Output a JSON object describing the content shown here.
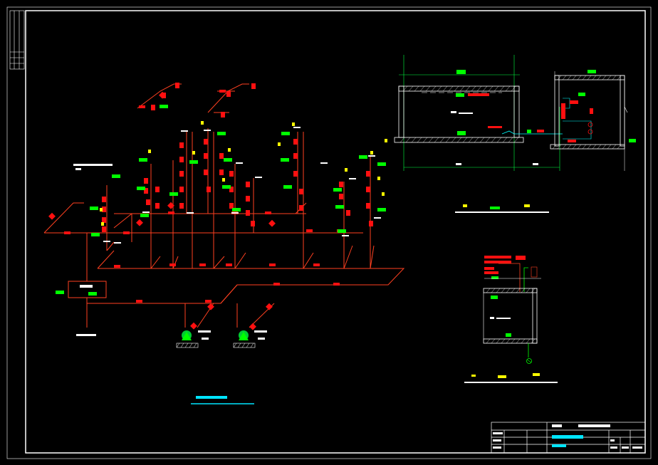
{
  "drawing": {
    "background": "#000000",
    "colors": {
      "frame": "#ffffff",
      "pipe": "#ff4020",
      "valve": "#ff1010",
      "tag": "#00ff00",
      "tag_alt": "#ffff00",
      "title": "#00e5ff",
      "wall": "#ffffff",
      "water": "#00ffff"
    }
  },
  "left_strip": {
    "cells": 5
  },
  "main_system": {
    "title_bar_color": "#00e5ff",
    "risers": 9,
    "pumps": 2,
    "tank_label": "",
    "note_label": ""
  },
  "plan_view": {
    "title_color": "#ffffff"
  },
  "detail_view": {
    "title_color": "#ffffff"
  },
  "title_block": {
    "rows": 4,
    "cols": 6,
    "project_color": "#00e5ff"
  }
}
